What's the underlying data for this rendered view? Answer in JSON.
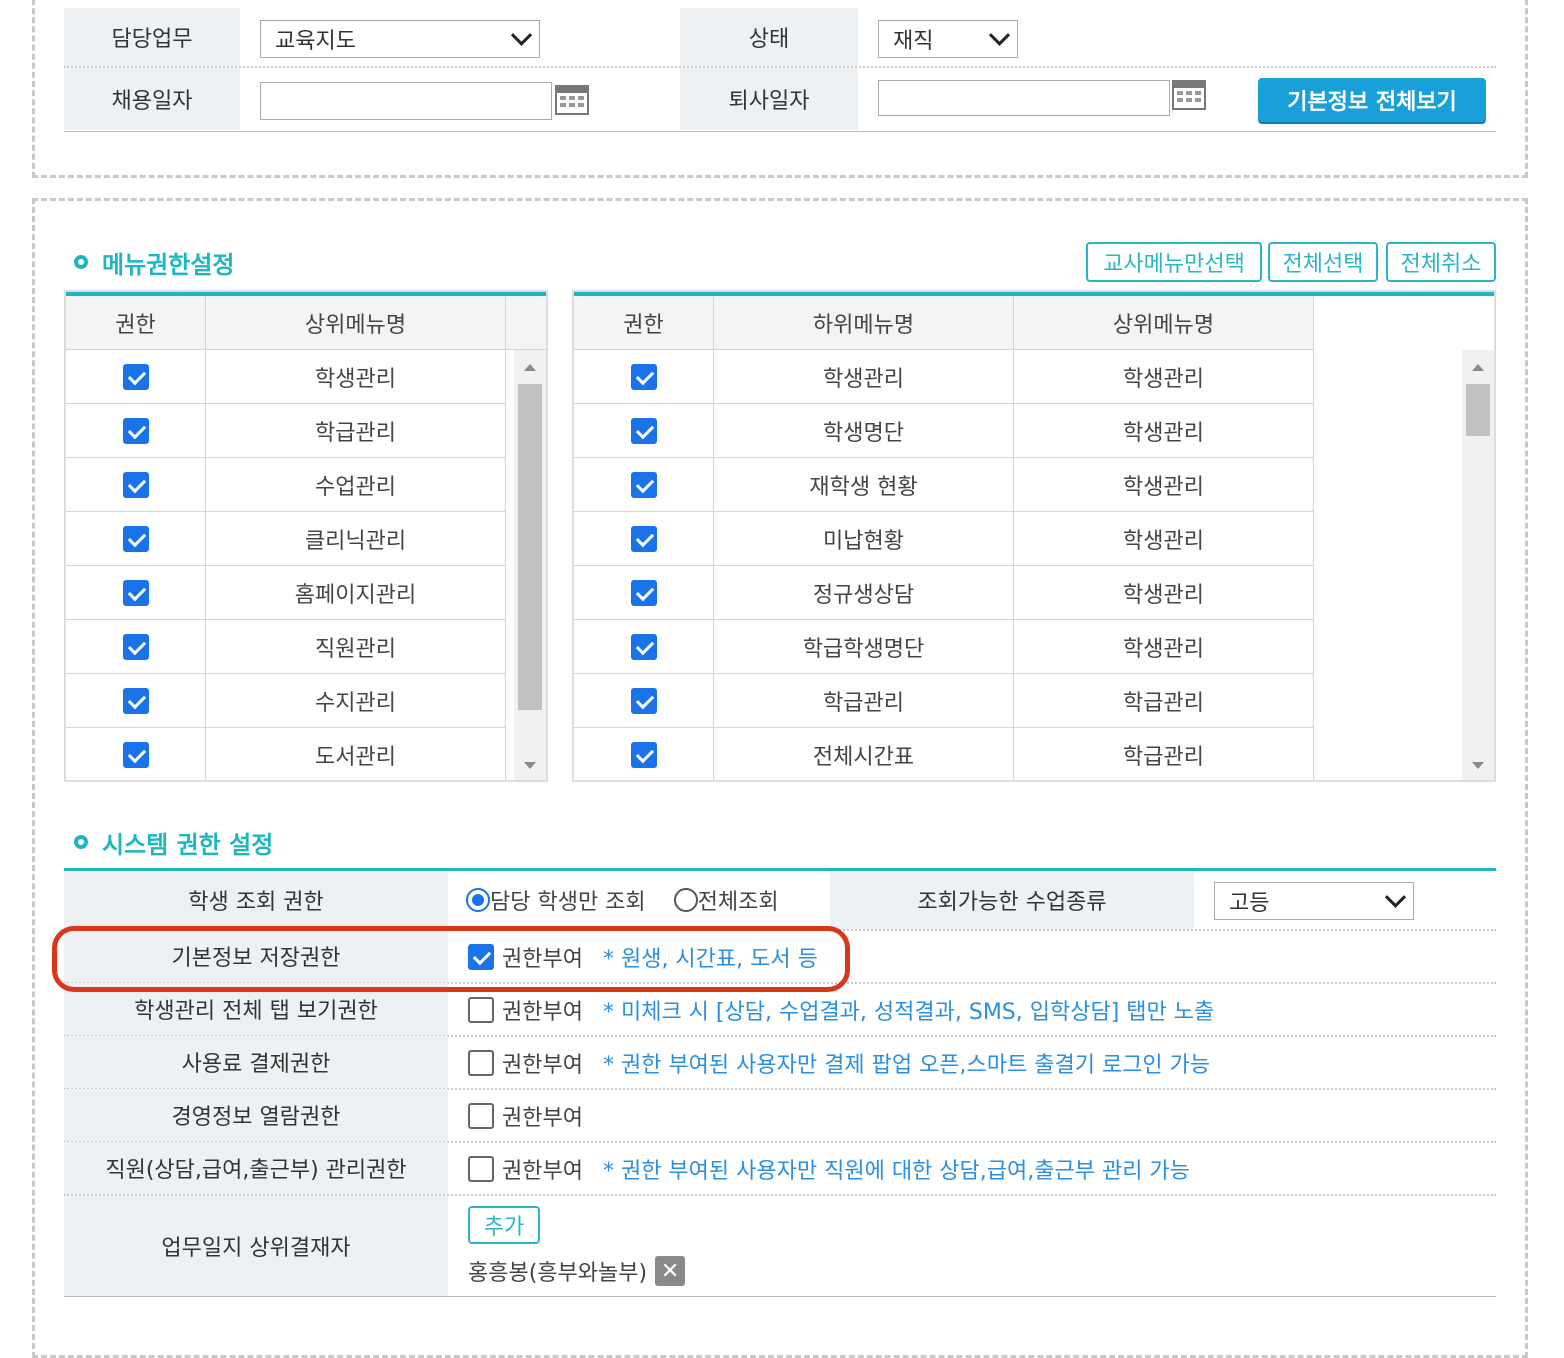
{
  "basic": {
    "duty_label": "담당업무",
    "duty_value": "교육지도",
    "status_label": "상태",
    "status_value": "재직",
    "hire_label": "채용일자",
    "hire_value": "",
    "retire_label": "퇴사일자",
    "retire_value": "",
    "view_all_button": "기본정보 전체보기"
  },
  "menu_perm": {
    "title": "메뉴권한설정",
    "buttons": [
      "교사메뉴만선택",
      "전체선택",
      "전체취소"
    ],
    "left": {
      "headers": [
        "권한",
        "상위메뉴명"
      ],
      "rows": [
        {
          "checked": true,
          "name": "학생관리"
        },
        {
          "checked": true,
          "name": "학급관리"
        },
        {
          "checked": true,
          "name": "수업관리"
        },
        {
          "checked": true,
          "name": "클리닉관리"
        },
        {
          "checked": true,
          "name": "홈페이지관리"
        },
        {
          "checked": true,
          "name": "직원관리"
        },
        {
          "checked": true,
          "name": "수지관리"
        },
        {
          "checked": true,
          "name": "도서관리"
        }
      ]
    },
    "right": {
      "headers": [
        "권한",
        "하위메뉴명",
        "상위메뉴명"
      ],
      "rows": [
        {
          "checked": true,
          "sub": "학생관리",
          "parent": "학생관리"
        },
        {
          "checked": true,
          "sub": "학생명단",
          "parent": "학생관리"
        },
        {
          "checked": true,
          "sub": "재학생 현황",
          "parent": "학생관리"
        },
        {
          "checked": true,
          "sub": "미납현황",
          "parent": "학생관리"
        },
        {
          "checked": true,
          "sub": "정규생상담",
          "parent": "학생관리"
        },
        {
          "checked": true,
          "sub": "학급학생명단",
          "parent": "학생관리"
        },
        {
          "checked": true,
          "sub": "학급관리",
          "parent": "학급관리"
        },
        {
          "checked": true,
          "sub": "전체시간표",
          "parent": "학급관리"
        }
      ]
    }
  },
  "system_perm": {
    "title": "시스템 권한 설정",
    "student_view": {
      "label": "학생 조회 권한",
      "opt1": "담당 학생만 조회",
      "opt2": "전체조회",
      "class_type_label": "조회가능한 수업종류",
      "class_type_value": "고등"
    },
    "rows": [
      {
        "label": "기본정보 저장권한",
        "checked": true,
        "check_label": "권한부여",
        "note": "* 원생, 시간표, 도서 등"
      },
      {
        "label": "학생관리 전체 탭 보기권한",
        "checked": false,
        "check_label": "권한부여",
        "note": "* 미체크 시 [상담, 수업결과, 성적결과, SMS, 입학상담] 탭만 노출"
      },
      {
        "label": "사용료 결제권한",
        "checked": false,
        "check_label": "권한부여",
        "note": "* 권한 부여된 사용자만 결제 팝업 오픈,스마트 출결기 로그인 가능"
      },
      {
        "label": "경영정보 열람권한",
        "checked": false,
        "check_label": "권한부여",
        "note": ""
      },
      {
        "label": "직원(상담,급여,출근부) 관리권한",
        "checked": false,
        "check_label": "권한부여",
        "note": "* 권한 부여된 사용자만 직원에 대한 상담,급여,출근부 관리 가능"
      }
    ],
    "approver": {
      "label": "업무일지 상위결재자",
      "add_button": "추가",
      "person": "홍흥봉(흥부와놀부)"
    }
  }
}
